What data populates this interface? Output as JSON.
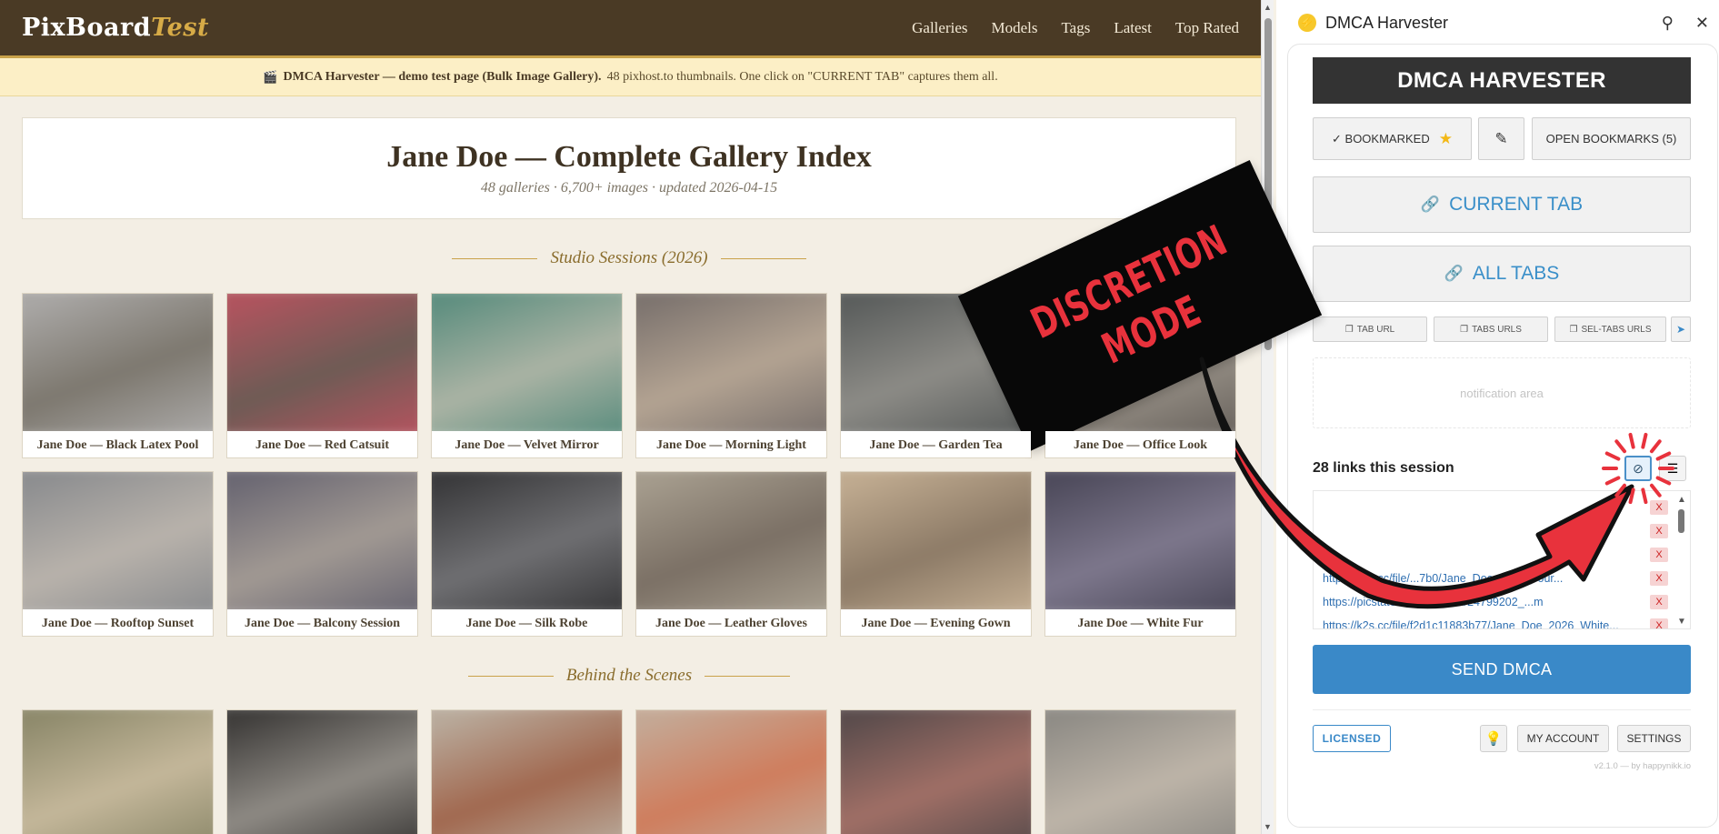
{
  "site": {
    "logo_main": "PixBoard",
    "logo_accent": "Test",
    "nav": [
      "Galleries",
      "Models",
      "Tags",
      "Latest",
      "Top Rated"
    ]
  },
  "banner": {
    "icon": "clapper-icon",
    "bold": "DMCA Harvester — demo test page (Bulk Image Gallery).",
    "rest": "48 pixhost.to thumbnails. One click on \"CURRENT TAB\" captures them all."
  },
  "gallery": {
    "title": "Jane Doe — Complete Gallery Index",
    "subtitle": "48 galleries · 6,700+ images · updated 2026-04-15",
    "sections": [
      {
        "title": "Studio Sessions (2026)",
        "items": [
          {
            "caption": "Jane Doe — Black Latex Pool",
            "colors": [
              "#a9a7a5",
              "#7d786f"
            ]
          },
          {
            "caption": "Jane Doe — Red Catsuit",
            "colors": [
              "#b0545e",
              "#6e5b55"
            ]
          },
          {
            "caption": "Jane Doe — Velvet Mirror",
            "colors": [
              "#5f8f80",
              "#aab3a4"
            ]
          },
          {
            "caption": "Jane Doe — Morning Light",
            "colors": [
              "#7d746f",
              "#b3a392"
            ]
          },
          {
            "caption": "Jane Doe — Garden Tea",
            "colors": [
              "#5b5e5d",
              "#8c8b86"
            ]
          },
          {
            "caption": "Jane Doe — Office Look",
            "colors": [
              "#6c6660",
              "#9b948a"
            ]
          },
          {
            "caption": "Jane Doe — Rooftop Sunset",
            "colors": [
              "#8d8e90",
              "#b8b2ab"
            ]
          },
          {
            "caption": "Jane Doe — Balcony Session",
            "colors": [
              "#6b6873",
              "#a19993"
            ]
          },
          {
            "caption": "Jane Doe — Silk Robe",
            "colors": [
              "#3a3a3c",
              "#6f6f72"
            ]
          },
          {
            "caption": "Jane Doe — Leather Gloves",
            "colors": [
              "#a59c8d",
              "#7b7065"
            ]
          },
          {
            "caption": "Jane Doe — Evening Gown",
            "colors": [
              "#c0ab90",
              "#8d7b67"
            ]
          },
          {
            "caption": "Jane Doe — White Fur",
            "colors": [
              "#4e4b5c",
              "#7d778c"
            ]
          }
        ]
      },
      {
        "title": "Behind the Scenes",
        "items": [
          {
            "colors": [
              "#8e8a6c",
              "#c4b79a"
            ]
          },
          {
            "colors": [
              "#3f3d3b",
              "#8e8a84"
            ]
          },
          {
            "colors": [
              "#b9ab9c",
              "#a1684f"
            ]
          },
          {
            "colors": [
              "#c4a996",
              "#cf7d5d"
            ]
          },
          {
            "colors": [
              "#5a4c4c",
              "#a06f66"
            ]
          },
          {
            "colors": [
              "#8f8c86",
              "#bdb4a8"
            ]
          }
        ]
      }
    ]
  },
  "ext": {
    "window_title": "DMCA Harvester",
    "header": "DMCA HARVESTER",
    "bookmarked_label": "✓ BOOKMARKED",
    "open_bookmarks_label": "OPEN BOOKMARKS (5)",
    "current_tab_label": "CURRENT TAB",
    "all_tabs_label": "ALL TABS",
    "tab_url_label": "TAB URL",
    "tabs_urls_label": "TABS URLS",
    "sel_tabs_urls_label": "SEL-TABS URLS",
    "notification_placeholder": "notification area",
    "links_session": "28 links this session",
    "links": [
      {
        "url": "",
        "remove": "X"
      },
      {
        "url": "",
        "remove": "X"
      },
      {
        "url": "",
        "remove": "X"
      },
      {
        "url": "https://k2s.cc/file/...7b0/Jane_Doe_2026_Your...",
        "remove": "X"
      },
      {
        "url": "https://picstate.com/view/full/24799202_...m",
        "remove": "X"
      },
      {
        "url": "https://k2s.cc/file/f2d1c11883b77/Jane_Doe_2026_White...",
        "remove": "X"
      }
    ],
    "send_label": "SEND DMCA",
    "licensed_label": "LICENSED",
    "my_account_label": "MY ACCOUNT",
    "settings_label": "SETTINGS",
    "version": "v2.1.0 — by happynikk.io"
  },
  "overlay": {
    "line1": "DISCRETION",
    "line2": "MODE",
    "arrow_color": "#e8323c"
  }
}
